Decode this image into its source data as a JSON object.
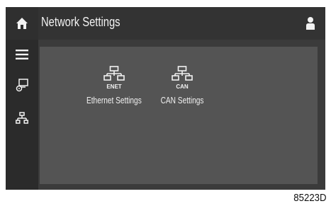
{
  "header": {
    "title": "Network Settings",
    "home_icon": "home-icon",
    "user_icon": "user-icon"
  },
  "sidebar": {
    "items": [
      {
        "icon": "menu-icon"
      },
      {
        "icon": "settings-monitor-icon"
      },
      {
        "icon": "network-icon"
      }
    ]
  },
  "tiles": [
    {
      "label": "Ethernet Settings",
      "icon_text": "ENET",
      "icon": "ethernet-network-icon"
    },
    {
      "label": "CAN Settings",
      "icon_text": "CAN",
      "icon": "can-network-icon"
    }
  ],
  "caption": {
    "text": "85223D"
  },
  "colors": {
    "screen_bg": "#3b3b3b",
    "topbar_bg": "#333333",
    "sidebar_bg": "#2b2b2b",
    "content_bg": "#545454",
    "text": "#f2f2f2"
  }
}
